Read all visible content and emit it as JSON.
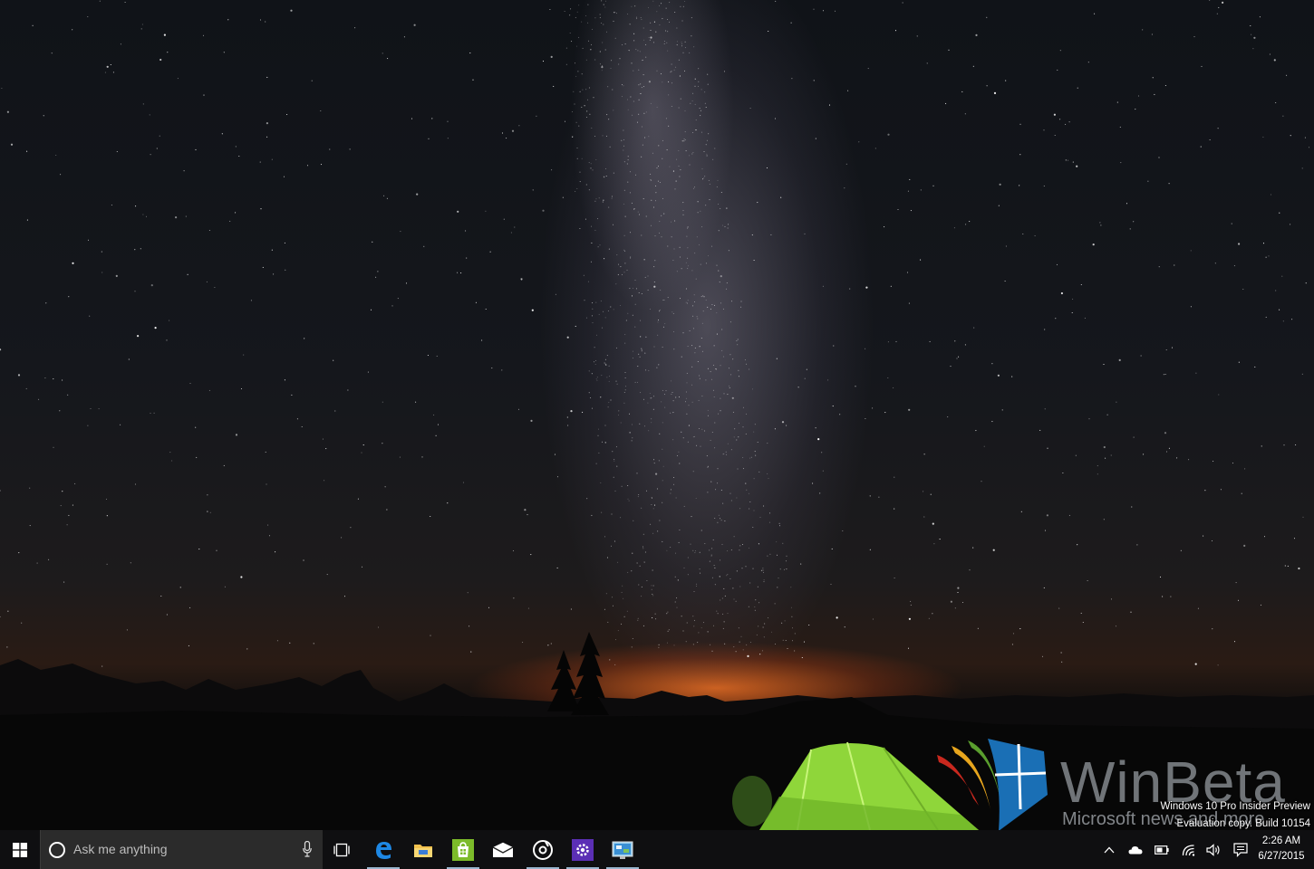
{
  "taskbar": {
    "search": {
      "placeholder": "Ask me anything"
    },
    "pinned_apps": [
      {
        "name": "Task View"
      },
      {
        "name": "Microsoft Edge"
      },
      {
        "name": "File Explorer"
      },
      {
        "name": "Store"
      },
      {
        "name": "Mail"
      },
      {
        "name": "Groove Music"
      },
      {
        "name": "Settings"
      },
      {
        "name": "Control Panel"
      }
    ],
    "tray": {
      "time": "2:26 AM",
      "date": "6/27/2015"
    }
  },
  "desktop": {
    "watermark": {
      "brand": "WinBeta",
      "tagline": "Microsoft news and more"
    },
    "evaluation_notice": {
      "line1": "Windows 10 Pro Insider Preview",
      "line2": "Evaluation copy. Build 10154"
    }
  },
  "colors": {
    "taskbar": "#101012",
    "search_box": "#2b2b2b",
    "accent": "#9ab6cf",
    "tent": "#8fd63a",
    "horizon_glow": "#eb6e23"
  }
}
